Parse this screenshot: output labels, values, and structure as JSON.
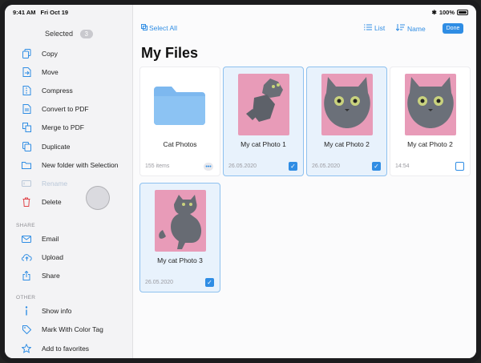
{
  "status": {
    "time": "9:41 AM",
    "date": "Fri Oct 19",
    "battery": "100%"
  },
  "sidebar": {
    "header": "Selected",
    "count": "3",
    "items": [
      {
        "label": "Copy",
        "icon": "copy-icon"
      },
      {
        "label": "Move",
        "icon": "move-icon"
      },
      {
        "label": "Compress",
        "icon": "compress-icon"
      },
      {
        "label": "Convert to PDF",
        "icon": "pdf-icon"
      },
      {
        "label": "Merge to PDF",
        "icon": "merge-icon"
      },
      {
        "label": "Duplicate",
        "icon": "duplicate-icon"
      },
      {
        "label": "New folder with Selection",
        "icon": "new-folder-icon"
      },
      {
        "label": "Rename",
        "icon": "rename-icon"
      },
      {
        "label": "Delete",
        "icon": "trash-icon"
      }
    ],
    "share_label": "SHARE",
    "share_items": [
      {
        "label": "Email",
        "icon": "mail-icon"
      },
      {
        "label": "Upload",
        "icon": "cloud-upload-icon"
      },
      {
        "label": "Share",
        "icon": "share-icon"
      }
    ],
    "other_label": "OTHER",
    "other_items": [
      {
        "label": "Show info",
        "icon": "info-icon"
      },
      {
        "label": "Mark With Color Tag",
        "icon": "tag-icon"
      },
      {
        "label": "Add to favorites",
        "icon": "star-icon"
      }
    ]
  },
  "toolbar": {
    "select_all": "Select All",
    "list": "List",
    "name": "Name",
    "done": "Done"
  },
  "title": "My Files",
  "files": [
    {
      "name": "Cat Photos",
      "meta": "155 items",
      "type": "folder",
      "selected": false
    },
    {
      "name": "My cat Photo 1",
      "meta": "26.05.2020",
      "type": "image",
      "selected": true
    },
    {
      "name": "My cat Photo 2",
      "meta": "26.05.2020",
      "type": "image",
      "selected": true
    },
    {
      "name": "My cat Photo 2",
      "meta": "14:54",
      "type": "image",
      "selected": false
    },
    {
      "name": "My cat Photo 3",
      "meta": "26.05.2020",
      "type": "image",
      "selected": true
    }
  ],
  "colors": {
    "accent": "#2f8de4",
    "delete": "#e0454a",
    "folder": "#7db8ef",
    "photo_bg": "#e89bb8"
  }
}
